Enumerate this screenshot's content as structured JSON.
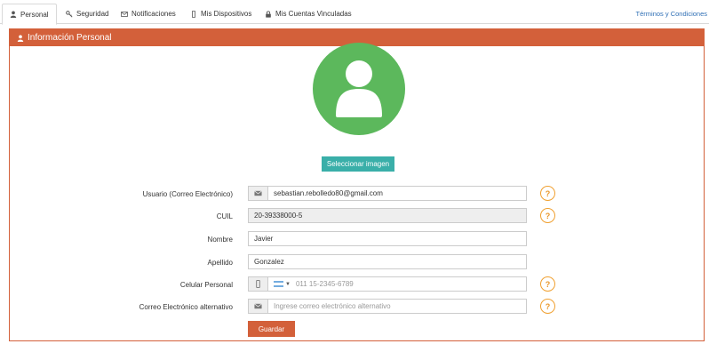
{
  "tabs": [
    {
      "label": "Personal",
      "icon": "user-icon"
    },
    {
      "label": "Seguridad",
      "icon": "key-icon"
    },
    {
      "label": "Notificaciones",
      "icon": "envelope-icon"
    },
    {
      "label": "Mis Dispositivos",
      "icon": "mobile-icon"
    },
    {
      "label": "Mis Cuentas Vinculadas",
      "icon": "lock-icon"
    }
  ],
  "terms_link": "Términos y Condiciones",
  "panel": {
    "title": "Información Personal"
  },
  "select_image_label": "Seleccionar imagen",
  "form": {
    "email": {
      "label": "Usuario (Correo Electrónico)",
      "value": "sebastian.rebolledo80@gmail.com"
    },
    "cuil": {
      "label": "CUIL",
      "value": "20-39338000-5"
    },
    "nombre": {
      "label": "Nombre",
      "value": "Javier"
    },
    "apellido": {
      "label": "Apellido",
      "value": "Gonzalez"
    },
    "celular": {
      "label": "Celular Personal",
      "placeholder": "011 15-2345-6789"
    },
    "alt_email": {
      "label": "Correo Electrónico alternativo",
      "placeholder": "Ingrese correo electrónico alternativo"
    }
  },
  "help_symbol": "?",
  "save_label": "Guardar",
  "colors": {
    "accent": "#d3603a",
    "avatar": "#5cb85c",
    "teal": "#3aafa9",
    "help": "#e8962a",
    "link": "#2f6fb5"
  }
}
